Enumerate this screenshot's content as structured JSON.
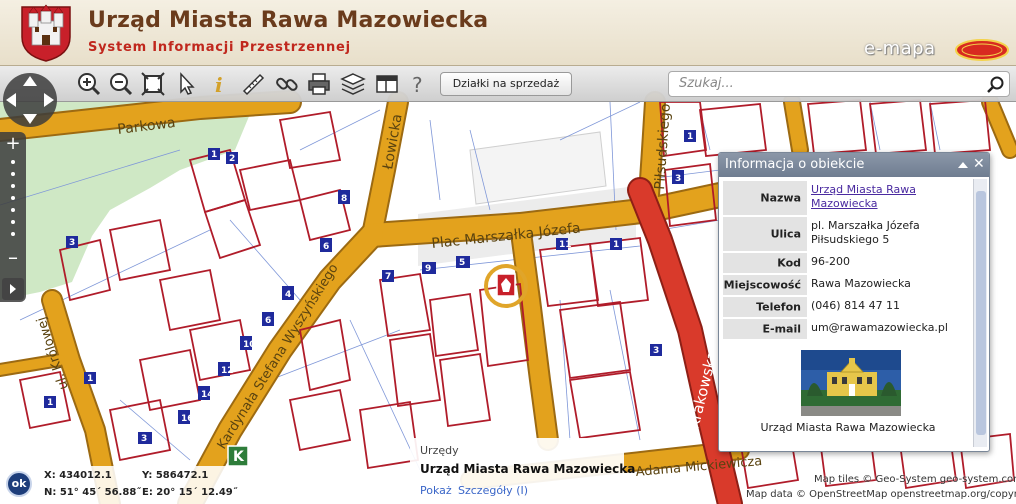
{
  "header": {
    "title": "Urząd Miasta Rawa Mazowiecka",
    "subtitle": "System Informacji Przestrzennej",
    "brand": "e-mapa",
    "brand_badge": "GEO-SYSTEM",
    "crest_icon": "city-crest-icon"
  },
  "toolbar": {
    "tools": [
      "zoom-in-icon",
      "zoom-out-icon",
      "full-extent-icon",
      "select-arrow-icon",
      "info-icon",
      "measure-ruler-icon",
      "link-icon",
      "print-icon",
      "layers-icon",
      "layout-icon",
      "help-icon"
    ],
    "parcels_button": "Działki na sprzedaż",
    "search_placeholder": "Szukaj..."
  },
  "map": {
    "streets": {
      "parkowa": "Parkowa",
      "lowicka": "Łowicka",
      "pilsudskiego": "Piłsudskiego",
      "plac": "Plac Marszałka Józefa",
      "krakowska": "Krakowska",
      "wyszynskiego": "Kardynała Stefana Wyszyńskiego",
      "krolowej": "ul. Królowej",
      "mickiewicza": "Adama Mickiewicza"
    },
    "parcel_numbers": [
      "1",
      "2",
      "4",
      "5",
      "6",
      "7",
      "8",
      "9",
      "10",
      "11",
      "12",
      "13",
      "14",
      "16",
      "18"
    ],
    "marker_letter": "K",
    "colors": {
      "road_fill": "#e3a21d",
      "road_edge": "#9c6a12",
      "main_road": "#d93a2b",
      "parcel": "#b01c2a",
      "park": "#cfe8c5",
      "house_no": "#1f2a9c"
    }
  },
  "info_panel": {
    "title": "Informacja o obiekcie",
    "rows": [
      {
        "key": "Nazwa",
        "value": "Urząd Miasta Rawa Mazowiecka"
      },
      {
        "key": "Ulica",
        "value": "pl. Marszałka Józefa Piłsudskiego 5"
      },
      {
        "key": "Kod",
        "value": "96-200"
      },
      {
        "key": "Miejscowość",
        "value": "Rawa Mazowiecka"
      },
      {
        "key": "Telefon",
        "value": "(046) 814 47 11"
      },
      {
        "key": "E-mail",
        "value": "um@rawamazowiecka.pl"
      }
    ],
    "photo_caption": "Urząd Miasta Rawa Mazowiecka"
  },
  "tooltip": {
    "category": "Urzędy",
    "name": "Urząd Miasta Rawa Mazowiecka",
    "show_link": "Pokaż",
    "details_link": "Szczegóły (I)"
  },
  "coordinates": {
    "ok_label": "ok",
    "x": "X: 434012.1",
    "y": "Y: 586472.1",
    "n": "N: 51° 45´ 56.88˝",
    "e": "E: 20° 15´ 12.49˝"
  },
  "attribution": {
    "line1": "Map tiles © Geo-System geo-system.com.pl",
    "line2": "Map data © OpenStreetMap openstreetmap.org/copyright"
  }
}
